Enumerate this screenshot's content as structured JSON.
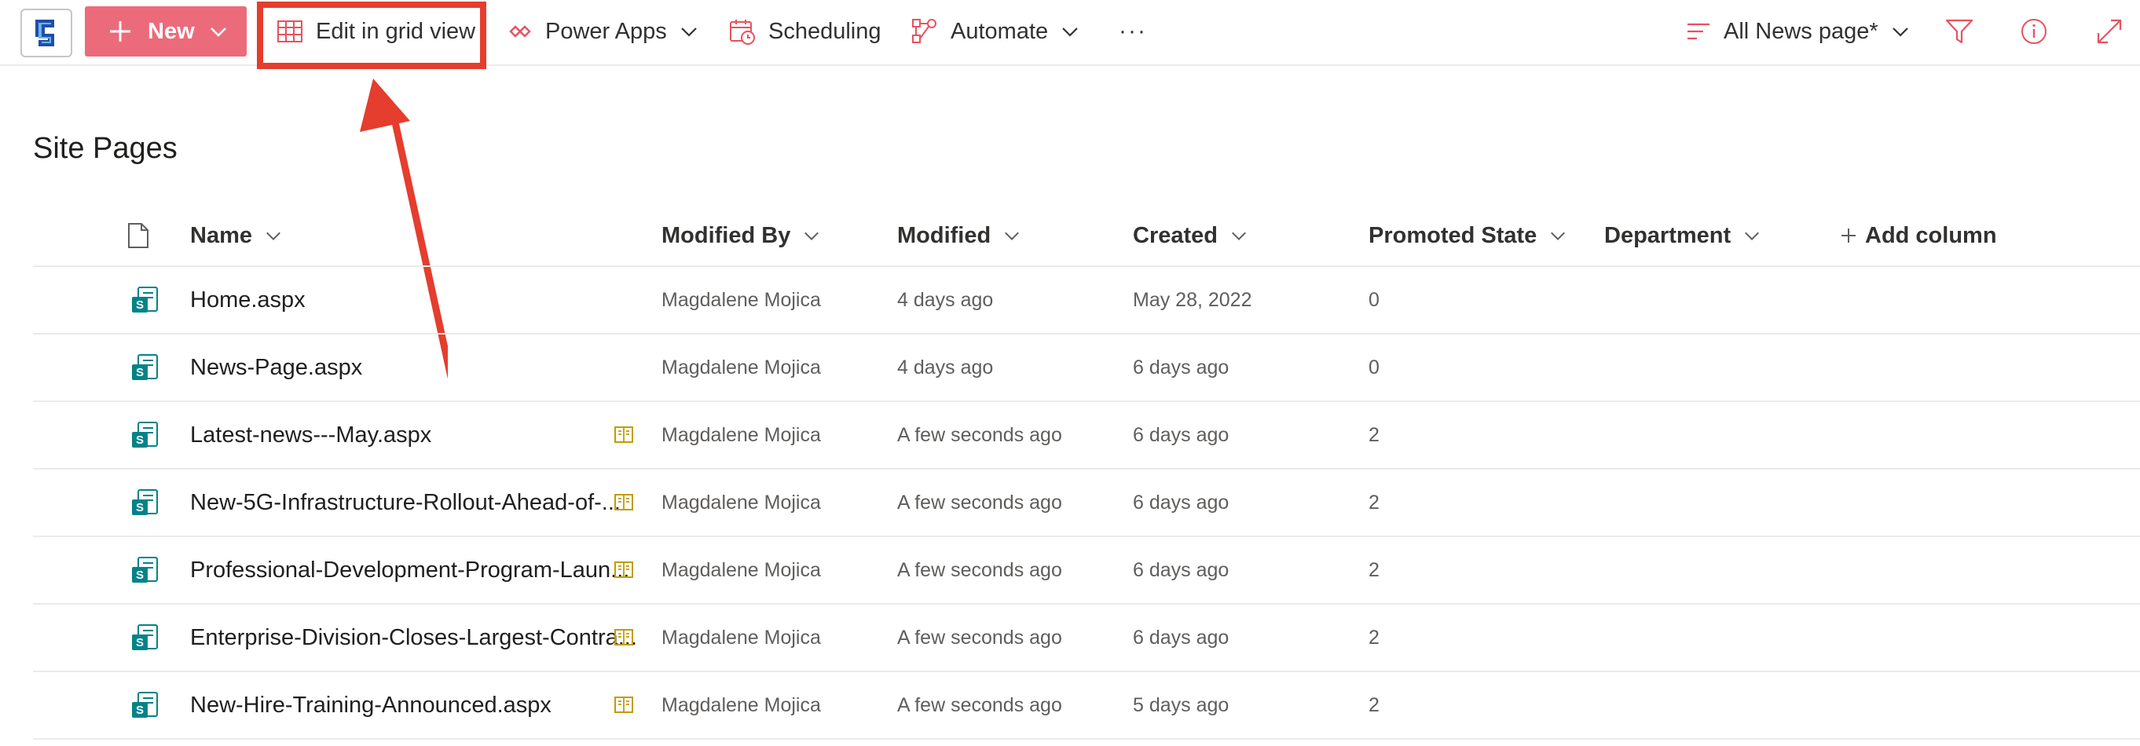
{
  "toolbar": {
    "new_label": "New",
    "edit_grid_label": "Edit in grid view",
    "power_apps_label": "Power Apps",
    "scheduling_label": "Scheduling",
    "automate_label": "Automate",
    "more_label": "···",
    "view_label": "All News page*"
  },
  "icons": {
    "app": "sharepoint-logo-icon",
    "new": "plus-icon",
    "edit_grid": "grid-icon",
    "power_apps": "power-apps-icon",
    "scheduling": "calendar-icon",
    "automate": "flow-icon",
    "view": "lines-icon",
    "filter": "filter-icon",
    "info": "info-icon",
    "expand": "expand-icon",
    "page": "sharepoint-page-icon",
    "news": "book-icon"
  },
  "colors": {
    "accent": "#ec6b7b",
    "accent_icon": "#e8525f",
    "highlight": "#e53d2e",
    "page_icon": "#038387",
    "book_icon": "#c19c00"
  },
  "page": {
    "title": "Site Pages"
  },
  "columns": {
    "name": "Name",
    "modified_by": "Modified By",
    "modified": "Modified",
    "created": "Created",
    "promoted_state": "Promoted State",
    "department": "Department",
    "add_column": "Add column"
  },
  "rows": [
    {
      "name": "Home.aspx",
      "modified_by": "Magdalene Mojica",
      "modified": "4 days ago",
      "created": "May 28, 2022",
      "promoted_state": "0",
      "news": false
    },
    {
      "name": "News-Page.aspx",
      "modified_by": "Magdalene Mojica",
      "modified": "4 days ago",
      "created": "6 days ago",
      "promoted_state": "0",
      "news": false
    },
    {
      "name": "Latest-news---May.aspx",
      "modified_by": "Magdalene Mojica",
      "modified": "A few seconds ago",
      "created": "6 days ago",
      "promoted_state": "2",
      "news": true
    },
    {
      "name": "New-5G-Infrastructure-Rollout-Ahead-of-...",
      "modified_by": "Magdalene Mojica",
      "modified": "A few seconds ago",
      "created": "6 days ago",
      "promoted_state": "2",
      "news": true
    },
    {
      "name": "Professional-Development-Program-Laun...",
      "modified_by": "Magdalene Mojica",
      "modified": "A few seconds ago",
      "created": "6 days ago",
      "promoted_state": "2",
      "news": true
    },
    {
      "name": "Enterprise-Division-Closes-Largest-Contra...",
      "modified_by": "Magdalene Mojica",
      "modified": "A few seconds ago",
      "created": "6 days ago",
      "promoted_state": "2",
      "news": true
    },
    {
      "name": "New-Hire-Training-Announced.aspx",
      "modified_by": "Magdalene Mojica",
      "modified": "A few seconds ago",
      "created": "5 days ago",
      "promoted_state": "2",
      "news": true
    }
  ]
}
